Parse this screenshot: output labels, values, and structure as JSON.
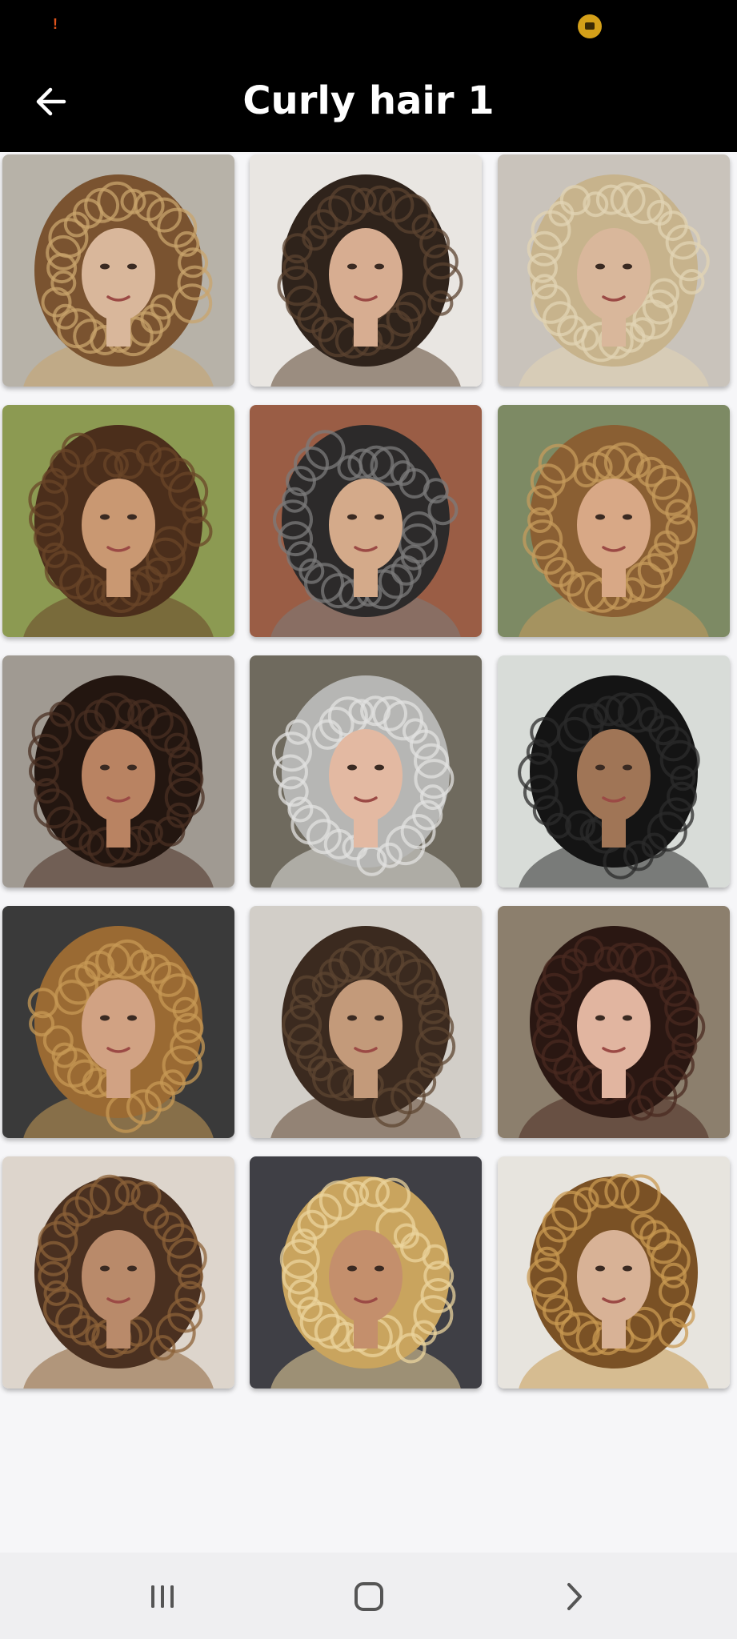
{
  "status_bar": {
    "alert_glyph": "!",
    "badge_color": "#d4a019"
  },
  "header": {
    "title": "Curly hair 1",
    "back_icon": "arrow-left-icon"
  },
  "gallery": {
    "columns": 3,
    "rows": 5,
    "items": [
      {
        "name": "curly-photo-1",
        "bg": "#b7b2a8",
        "hair": "#7a5330",
        "accent": "#c9a46c",
        "skin": "#d9b79b"
      },
      {
        "name": "curly-photo-2",
        "bg": "#e9e6e2",
        "hair": "#2f231b",
        "accent": "#5b4330",
        "skin": "#d7ad91"
      },
      {
        "name": "curly-photo-3",
        "bg": "#c9c3bb",
        "hair": "#c7b38c",
        "accent": "#e2d4b4",
        "skin": "#d9b79b"
      },
      {
        "name": "curly-photo-4",
        "bg": "#8c9a52",
        "hair": "#4b2e1b",
        "accent": "#6a4628",
        "skin": "#c99872"
      },
      {
        "name": "curly-photo-5",
        "bg": "#9a5d45",
        "hair": "#2c2a2a",
        "accent": "#7b7b7b",
        "skin": "#d4aa8a"
      },
      {
        "name": "curly-photo-6",
        "bg": "#7d8a64",
        "hair": "#8a5f33",
        "accent": "#c69b5c",
        "skin": "#d8a886"
      },
      {
        "name": "curly-photo-7",
        "bg": "#a09a92",
        "hair": "#231610",
        "accent": "#4a2f22",
        "skin": "#b98362"
      },
      {
        "name": "curly-photo-8",
        "bg": "#6f6a5e",
        "hair": "#b6b6b4",
        "accent": "#e2e2e0",
        "skin": "#e3b9a2"
      },
      {
        "name": "curly-photo-9",
        "bg": "#d8dcd8",
        "hair": "#141414",
        "accent": "#2b2b2b",
        "skin": "#a07556"
      },
      {
        "name": "curly-photo-10",
        "bg": "#3a3a3a",
        "hair": "#9a6a33",
        "accent": "#c79a55",
        "skin": "#d1a283"
      },
      {
        "name": "curly-photo-11",
        "bg": "#d2cec8",
        "hair": "#3b2a1f",
        "accent": "#5e4531",
        "skin": "#c39a7a"
      },
      {
        "name": "curly-photo-12",
        "bg": "#8c7f6d",
        "hair": "#2a1712",
        "accent": "#4a2a20",
        "skin": "#e1b5a0"
      },
      {
        "name": "curly-photo-13",
        "bg": "#ddd5cc",
        "hair": "#4a3020",
        "accent": "#8c6238",
        "skin": "#b98a6a"
      },
      {
        "name": "curly-photo-14",
        "bg": "#3f3f45",
        "hair": "#c9a45e",
        "accent": "#ebd49d",
        "skin": "#c48f6c"
      },
      {
        "name": "curly-photo-15",
        "bg": "#e7e4de",
        "hair": "#7a5125",
        "accent": "#c99a52",
        "skin": "#d8b296"
      }
    ]
  },
  "nav": {
    "recents_icon": "recents-icon",
    "home_icon": "home-icon",
    "back_icon": "chevron-right-icon"
  }
}
